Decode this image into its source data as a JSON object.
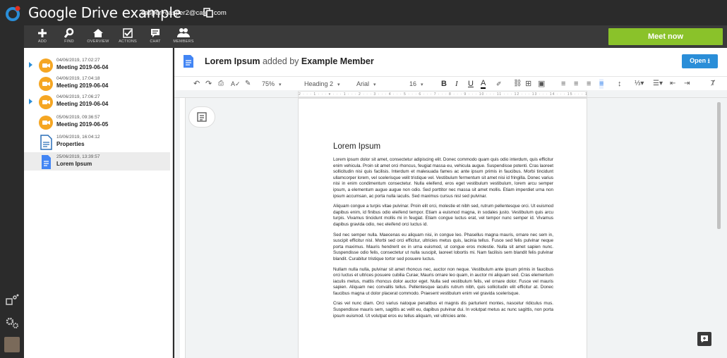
{
  "app": {
    "title": "Google Drive example",
    "user": "casper+casper2@cafex.com"
  },
  "toolbar": {
    "items": [
      {
        "label": "ADD",
        "icon": "plus-icon"
      },
      {
        "label": "FIND",
        "icon": "search-icon"
      },
      {
        "label": "OVERVIEW",
        "icon": "home-icon"
      },
      {
        "label": "ACTIONS",
        "icon": "checklist-icon"
      },
      {
        "label": "CHAT",
        "icon": "chat-icon"
      },
      {
        "label": "MEMBERS",
        "icon": "members-icon"
      }
    ],
    "meet_now": "Meet now"
  },
  "sidebar": {
    "items": [
      {
        "date": "04/06/2019, 17:02:27",
        "name": "Meeting 2019-06-04",
        "type": "meeting",
        "expandable": true
      },
      {
        "date": "04/06/2019, 17:04:18",
        "name": "Meeting 2019-06-04",
        "type": "meeting",
        "expandable": false
      },
      {
        "date": "04/06/2019, 17:06:27",
        "name": "Meeting 2019-06-04",
        "type": "meeting",
        "expandable": true
      },
      {
        "date": "05/06/2019, 09:36:57",
        "name": "Meeting 2019-06-05",
        "type": "meeting",
        "expandable": false
      },
      {
        "date": "10/06/2019, 16:04:12",
        "name": "Properties",
        "type": "properties",
        "expandable": false
      },
      {
        "date": "25/06/2019, 13:39:57",
        "name": "Lorem Ipsum",
        "type": "doc",
        "expandable": false
      }
    ]
  },
  "document": {
    "title": "Lorem Ipsum",
    "added_by_text": "added by",
    "author": "Example Member",
    "open_label": "Open ⭳",
    "toolbar": {
      "zoom": "75%",
      "style": "Heading 2",
      "font": "Arial",
      "size": "16"
    },
    "ruler": "2 · · · 1 · · · ▾ · · · 1 · · · 2 · · · 3 · · · 4 · · · 5 · · · 6 · · · 7 · · · 8 · · · 9 · · · 10 · · · 11 · · · 12 · · · 13 · · · 14 · · · 15 · · · 16 ▾ 17 · · · 18 · · · 19",
    "heading": "Lorem Ipsum",
    "paragraphs": [
      "Lorem ipsum dolor sit amet, consectetur adipiscing elit. Donec commodo quam quis odio interdum, quis efficitur enim vehicula. Proin sit amet orci rhoncus, feugiat massa eu, vehicula augue. Suspendisse potenti. Cras laoreet sollicitudin nisi quis facilisis. Interdum et malesuada fames ac ante ipsum primis in faucibus. Morbi tincidunt ullamcorper lorem, vel scelerisque velit tristique vel. Vestibulum fermentum sit amet nisi id fringilla. Donec varius nisi in enim condimentum consectetur. Nulla eleifend, eros eget vestibulum vestibulum, lorem arcu semper ipsum, a elementum augue augue non odio. Sed porttitor nec massa sit amet mollis. Etiam imperdiet urna non ipsum accumsan, ac porta nulla iaculis. Sed maximus cursus nisl sed pulvinar.",
      "Aliquam congue a turpis vitae pulvinar. Proin elit orci, molestie et nibh sed, rutrum pellentesque orci. Ut euismod dapibus enim, id finibus odio eleifend tempor. Etiam a euismod magna, in sodales justo. Vestibulum quis arcu turpis. Vivamus tincidunt mollis mi in feugiat. Etiam congue luctus erat, vel tempor nunc semper id. Vivamus dapibus gravida odio, nec eleifend orci luctus id.",
      "Sed nec semper nulla. Maecenas eu aliquam nisi, in congue leo. Phasellus magna mauris, ornare nec sem in, suscipit efficitur nisl. Morbi sed orci efficitur, ultricies metus quis, lacinia tellus. Fusce sed felis pulvinar neque porta maximus. Mauris hendrerit ex in urna euismod, ut congue eros molestie. Nulla sit amet sapien nunc. Suspendisse odio felis, consectetur ut nulla suscipit, laoreet lobortis mi. Nam facilisis sem blandit felis pulvinar blandit. Curabitur tristique tortor sed posuere luctus.",
      "Nullam nulla nulla, pulvinar sit amet rhoncus nec, auctor non neque. Vestibulum ante ipsum primis in faucibus orci luctus et ultrices posuere cubilia Curae; Mauris ornare leo quam, in auctor mi aliquam sed. Cras elementum iaculis metus, mattis rhoncus dolor auctor eget. Nulla sed vestibulum felis, vel ornare dolor. Fusce vel mauris sapien. Aliquam nec convallis tellus. Pellentesque iaculis rutrum nibh, quis sollicitudin elit efficitur at. Donec faucibus magna ut dolor placerat commodo. Praesent vestibulum enim vel gravida scelerisque.",
      "Cras vel nunc diam. Orci varius natoque penatibus et magnis dis parturient montes, nascetur ridiculus mus. Suspendisse mauris sem, sagittis ac velit eu, dapibus pulvinar dui. In volutpat metus ac nunc sagittis, non porta ipsum euismod. Ut volutpat eros eu tellus aliquam, vel ultricies ante."
    ]
  },
  "colors": {
    "accent_green": "#8ac22a",
    "accent_blue": "#2a8ed8",
    "meeting_orange": "#f5a623",
    "dark": "#2b2b2b"
  }
}
